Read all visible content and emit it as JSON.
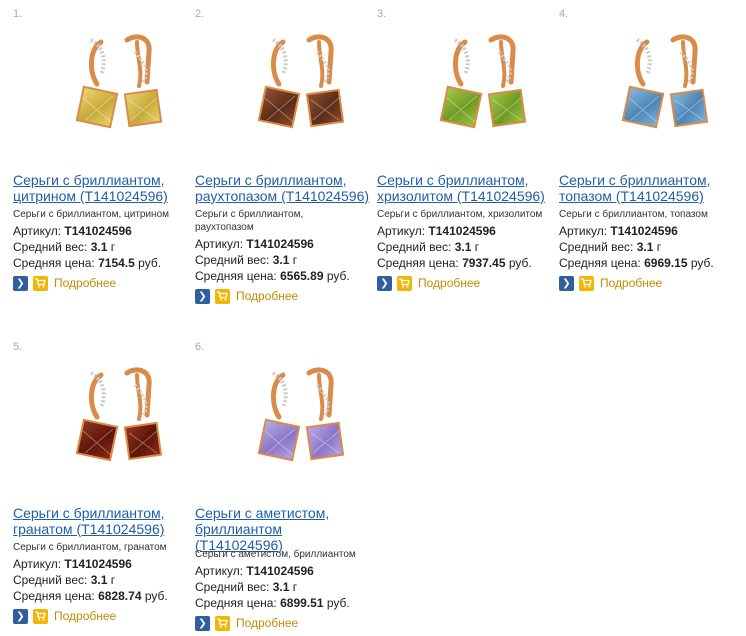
{
  "products": [
    {
      "index": "1.",
      "title_line1": "Серьги с бриллиантом,",
      "title_line2": "цитрином (T141024596)",
      "title_line3": "",
      "desc_line1": "Серьги с бриллиантом, цитрином",
      "desc_line2": "",
      "article_label": "Артикул:",
      "article": "T141024596",
      "weight_label": "Средний вес:",
      "weight": "3.1",
      "weight_unit": "г",
      "price_label": "Средняя цена:",
      "price": "7154.5",
      "currency": "руб.",
      "more_label": "Подробнее",
      "stone_color": "#e9d46a",
      "stone_dark": "#c7a93a"
    },
    {
      "index": "2.",
      "title_line1": "Серьги с бриллиантом,",
      "title_line2": "раухтопазом (T141024596)",
      "title_line3": "",
      "desc_line1": "Серьги с бриллиантом,",
      "desc_line2": "раухтопазом",
      "article_label": "Артикул:",
      "article": "T141024596",
      "weight_label": "Средний вес:",
      "weight": "3.1",
      "weight_unit": "г",
      "price_label": "Средняя цена:",
      "price": "6565.89",
      "currency": "руб.",
      "more_label": "Подробнее",
      "stone_color": "#8a4a2c",
      "stone_dark": "#5c2c16"
    },
    {
      "index": "3.",
      "title_line1": "Серьги с бриллиантом,",
      "title_line2": "хризолитом (T141024596)",
      "title_line3": "",
      "desc_line1": "Серьги с бриллиантом, хризолитом",
      "desc_line2": "",
      "article_label": "Артикул:",
      "article": "T141024596",
      "weight_label": "Средний вес:",
      "weight": "3.1",
      "weight_unit": "г",
      "price_label": "Средняя цена:",
      "price": "7937.45",
      "currency": "руб.",
      "more_label": "Подробнее",
      "stone_color": "#9cc742",
      "stone_dark": "#6f9a22"
    },
    {
      "index": "4.",
      "title_line1": "Серьги с бриллиантом,",
      "title_line2": "топазом (T141024596)",
      "title_line3": "",
      "desc_line1": "Серьги с бриллиантом, топазом",
      "desc_line2": "",
      "article_label": "Артикул:",
      "article": "T141024596",
      "weight_label": "Средний вес:",
      "weight": "3.1",
      "weight_unit": "г",
      "price_label": "Средняя цена:",
      "price": "6969.15",
      "currency": "руб.",
      "more_label": "Подробнее",
      "stone_color": "#7fb4dc",
      "stone_dark": "#4c86b6"
    },
    {
      "index": "5.",
      "title_line1": "Серьги с бриллиантом,",
      "title_line2": "гранатом (T141024596)",
      "title_line3": "",
      "desc_line1": "Серьги с бриллиантом, гранатом",
      "desc_line2": "",
      "article_label": "Артикул:",
      "article": "T141024596",
      "weight_label": "Средний вес:",
      "weight": "3.1",
      "weight_unit": "г",
      "price_label": "Средняя цена:",
      "price": "6828.74",
      "currency": "руб.",
      "more_label": "Подробнее",
      "stone_color": "#8e2a16",
      "stone_dark": "#5e150a"
    },
    {
      "index": "6.",
      "title_line1": "Серьги с аметистом,",
      "title_line2": "бриллиантом",
      "title_line3": "(T141024596)",
      "desc_line1": "Серьги с аметистом, бриллиантом",
      "desc_line2": "",
      "article_label": "Артикул:",
      "article": "T141024596",
      "weight_label": "Средний вес:",
      "weight": "3.1",
      "weight_unit": "г",
      "price_label": "Средняя цена:",
      "price": "6899.51",
      "currency": "руб.",
      "more_label": "Подробнее",
      "stone_color": "#b7a6e6",
      "stone_dark": "#8a76c6"
    }
  ],
  "colors": {
    "link": "#1f5ea8",
    "arrow_button": "#2f5f9e",
    "cart_button": "#f2b705",
    "more_link": "#c48b00",
    "gold": "#d9914f"
  },
  "icons": {
    "arrow": "arrow-right-icon",
    "cart": "cart-icon"
  }
}
